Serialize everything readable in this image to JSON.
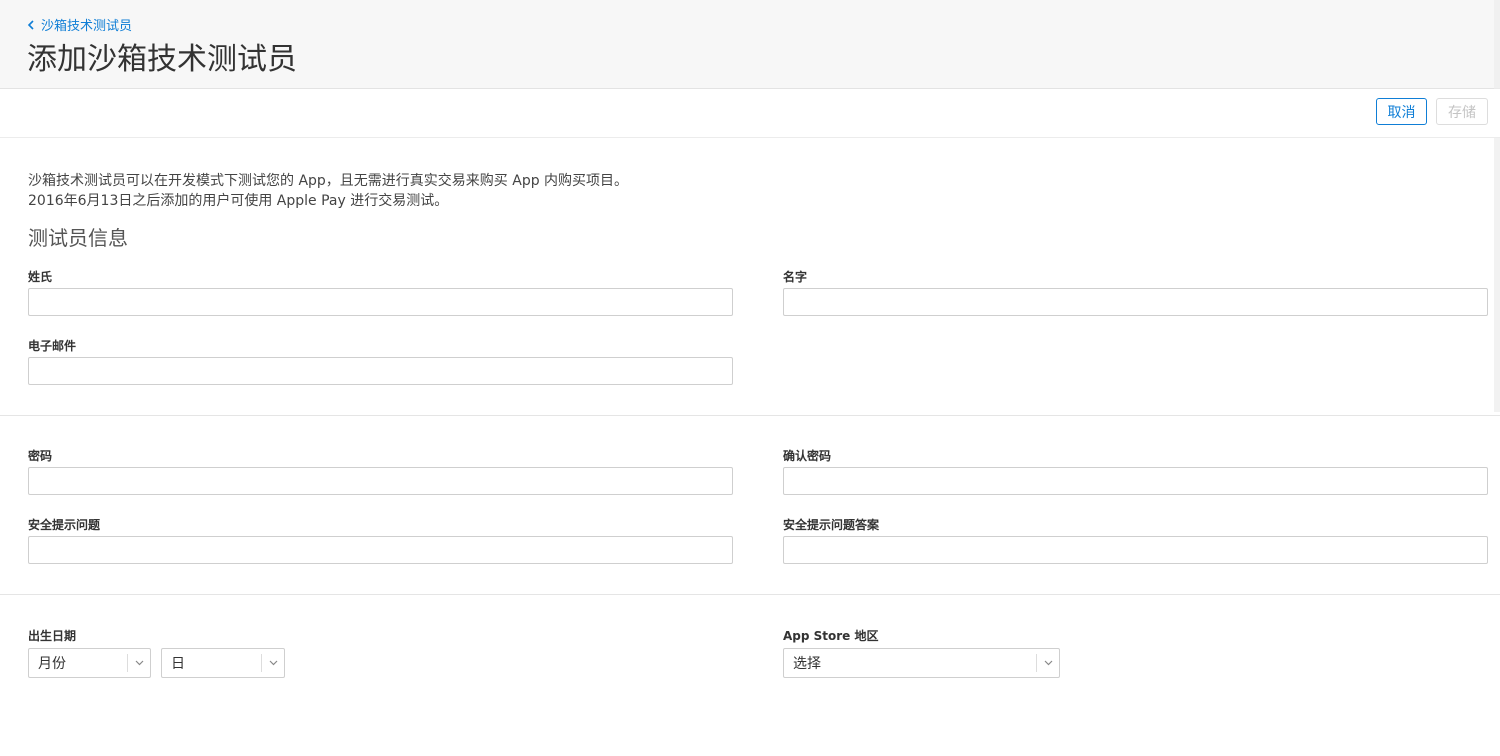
{
  "breadcrumb": {
    "label": "沙箱技术测试员"
  },
  "page_title": "添加沙箱技术测试员",
  "toolbar": {
    "cancel_label": "取消",
    "save_label": "存储"
  },
  "intro": {
    "line1": "沙箱技术测试员可以在开发模式下测试您的 App，且无需进行真实交易来购买 App 内购买项目。",
    "line2": "2016年6月13日之后添加的用户可使用 Apple Pay 进行交易测试。"
  },
  "section_title": "测试员信息",
  "fields": {
    "last_name": {
      "label": "姓氏",
      "value": ""
    },
    "first_name": {
      "label": "名字",
      "value": ""
    },
    "email": {
      "label": "电子邮件",
      "value": ""
    },
    "password": {
      "label": "密码",
      "value": ""
    },
    "confirm_password": {
      "label": "确认密码",
      "value": ""
    },
    "security_question": {
      "label": "安全提示问题",
      "value": ""
    },
    "security_answer": {
      "label": "安全提示问题答案",
      "value": ""
    },
    "birthdate": {
      "label": "出生日期",
      "month": "月份",
      "day": "日"
    },
    "region": {
      "label": "App Store 地区",
      "value": "选择"
    }
  },
  "colors": {
    "accent": "#0f7ed6",
    "header_bg": "#f7f7f7",
    "border": "#cfcfcf"
  },
  "icons": {
    "back": "chevron-left-icon",
    "dropdown": "chevron-down-icon"
  }
}
